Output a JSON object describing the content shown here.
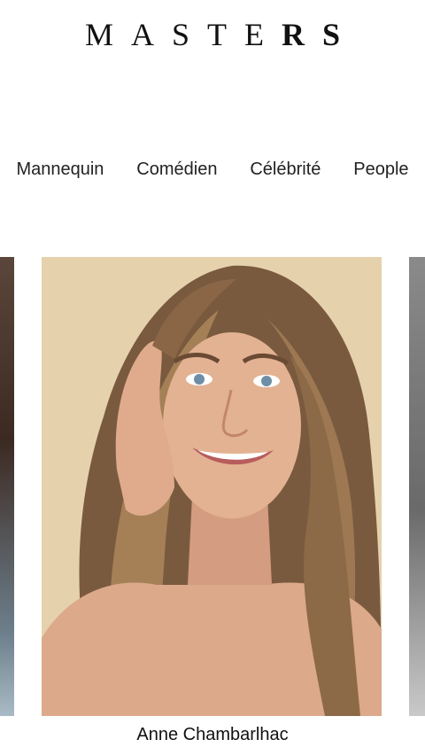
{
  "header": {
    "logo_light": "MASTE",
    "logo_heavy": "RS"
  },
  "nav": {
    "items": [
      "Mannequin",
      "Comédien",
      "Célébrité",
      "People"
    ]
  },
  "carousel": {
    "featured": {
      "name": "Anne Chambarlhac"
    }
  },
  "colors": {
    "background": "#ffffff",
    "text": "#1a1a1a",
    "photo_backdrop": "#e6d1ad"
  }
}
